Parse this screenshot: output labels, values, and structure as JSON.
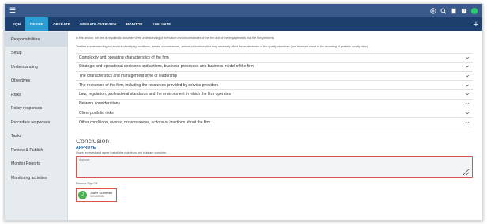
{
  "topbar": {
    "menu_icon": "hamburger-icon",
    "icons": [
      "add-circle-icon",
      "search-icon",
      "document-icon",
      "help-icon",
      "user-avatar"
    ]
  },
  "nav": {
    "tabs": [
      {
        "label": "SQM",
        "active": false
      },
      {
        "label": "DESIGN",
        "active": true
      },
      {
        "label": "OPERATE",
        "active": false
      },
      {
        "label": "OPERATE OVERVIEW",
        "active": false
      },
      {
        "label": "MONITOR",
        "active": false
      },
      {
        "label": "EVALUATE",
        "active": false
      }
    ],
    "plus_label": "+"
  },
  "sidebar": {
    "items": [
      {
        "label": "Responsibilities",
        "active": true
      },
      {
        "label": "Setup"
      },
      {
        "label": "Understanding"
      },
      {
        "label": "Objectives"
      },
      {
        "label": "Risks"
      },
      {
        "label": "Policy responses"
      },
      {
        "label": "Procedure responses"
      },
      {
        "label": "Tasks"
      },
      {
        "label": "Review & Publish"
      },
      {
        "label": "Monitor Reports"
      },
      {
        "label": "Monitoring activities"
      }
    ]
  },
  "main": {
    "intro1": "In this section, the firm is required to document their understanding of the nature and circumstances of the firm and of the engagements that the firm performs.",
    "intro2": "The firm's understanding will assist in identifying conditions, events, circumstances, actions or inactions that may adversely affect the achievement of the quality objectives (and therefore result in the recording of possible quality risks).",
    "accordion": [
      "Complexity and operating characteristics of the firm",
      "Strategic and operational decisions and actions, business processes and business model of the firm",
      "The characteristics and management style of leadership",
      "The resources of the firm, including the resources provided by service providers",
      "Law, regulation, professional standards and the environment in which the firm operates",
      "Network considerations",
      "Client portfolio risks",
      "Other conditions, events, circumstances, actions or inactions about the firm"
    ],
    "conclusion_title": "Conclusion",
    "approve_label": "APPROVE",
    "approve_sub": "I have reviewed and agree that all the objectives and risks are complete.",
    "approve_placeholder": "Approve",
    "remove_signoff": "Remove Sign Off",
    "signer": {
      "initial": "J",
      "name": "Joane Schneider",
      "date": "12/12/2022"
    }
  },
  "colors": {
    "topbar": "#3a5a8c",
    "navbar": "#1c3f6e",
    "active_tab": "#2a9fd6",
    "highlight_border": "#d9534f",
    "avatar_green": "#4caf50"
  }
}
